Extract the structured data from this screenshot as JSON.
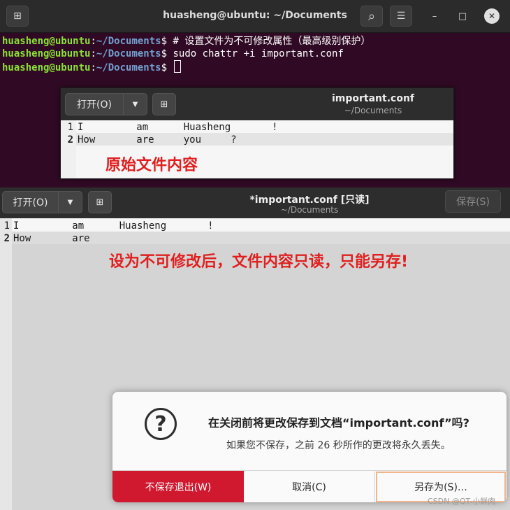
{
  "terminal": {
    "title": "huasheng@ubuntu: ~/Documents",
    "prompt_user": "huasheng@ubuntu",
    "prompt_sep": ":",
    "prompt_path": "~/Documents",
    "prompt_dollar": "$",
    "lines": [
      {
        "cmd": " # 设置文件为不可修改属性（最高级别保护）"
      },
      {
        "cmd": " sudo chattr +i important.conf"
      },
      {
        "cmd": " "
      }
    ]
  },
  "small_editor": {
    "open_label": "打开(O)",
    "file_name": "important.conf",
    "file_path": "~/Documents",
    "lines": [
      {
        "num": "1",
        "text": "I         am      Huasheng       !"
      },
      {
        "num": "2",
        "text": "How       are     you     ?"
      }
    ],
    "annotation": "原始文件内容"
  },
  "big_editor": {
    "open_label": "打开(O)",
    "file_name": "*important.conf [只读]",
    "file_path": "~/Documents",
    "save_label": "保存(S)",
    "lines": [
      {
        "num": "1",
        "text": "I         am      Huasheng       !"
      },
      {
        "num": "2",
        "text": "How       are"
      }
    ],
    "annotation": "设为不可修改后，文件内容只读，只能另存!"
  },
  "dialog": {
    "title": "在关闭前将更改保存到文档“important.conf”吗?",
    "subtitle": "如果您不保存，之前 26 秒所作的更改将永久丢失。",
    "discard_label": "不保存退出(W)",
    "cancel_label": "取消(C)",
    "saveas_label": "另存为(S)…",
    "accent_color": "#d0182f"
  },
  "watermark": "CSDN @QT-小鲜肉",
  "icons": {
    "new_tab": "⊞",
    "search": "⌕",
    "menu": "☰",
    "minimize": "–",
    "maximize": "□",
    "close": "✕",
    "dropdown": "▼",
    "question": "?"
  }
}
